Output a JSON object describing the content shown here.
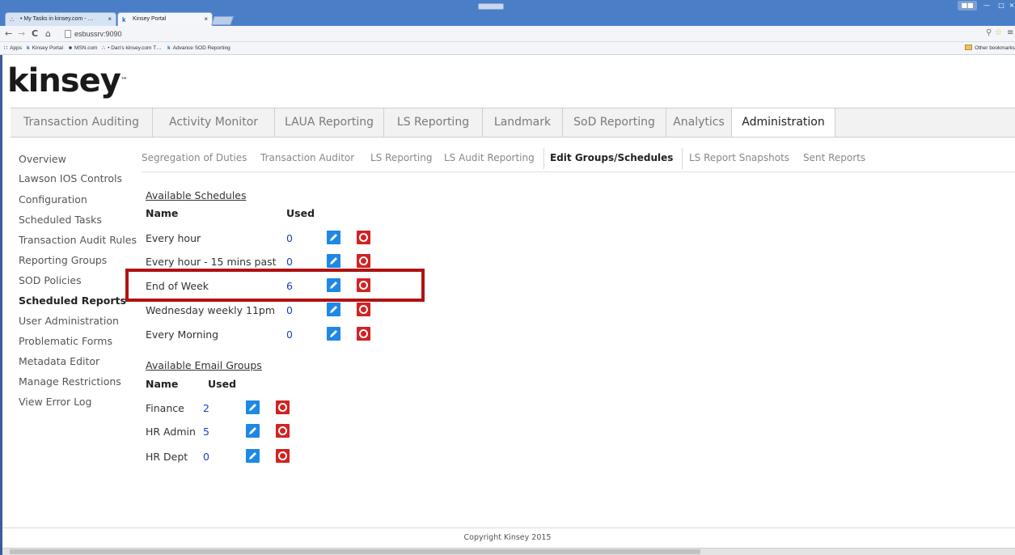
{
  "browser": {
    "tabs": [
      {
        "label": "• My Tasks in kinsey.com - …",
        "icon": "asana-icon"
      },
      {
        "label": "Kinsey Portal",
        "icon": "kinsey-icon"
      }
    ],
    "url": "esbussrv:9090",
    "bookmarks": [
      "Apps",
      "Kinsey Portal",
      "MSN.com",
      "• Dan's kinsey.com T…",
      "Advance SOD Reporting"
    ],
    "other_bookmarks": "Other bookmarks"
  },
  "logo": {
    "text": "kinsey",
    "mark": "™"
  },
  "topnav": [
    "Transaction Auditing",
    "Activity Monitor",
    "LAUA Reporting",
    "LS Reporting",
    "Landmark",
    "SoD Reporting",
    "Analytics",
    "Administration"
  ],
  "topnav_active": "Administration",
  "sidebar": [
    "Overview",
    "Lawson IOS Controls",
    "Configuration",
    "Scheduled Tasks",
    "Transaction Audit Rules",
    "Reporting Groups",
    "SOD Policies",
    "Scheduled Reports",
    "User Administration",
    "Problematic Forms",
    "Metadata Editor",
    "Manage Restrictions",
    "View Error Log"
  ],
  "sidebar_active": "Scheduled Reports",
  "subnav": [
    "Segregation of Duties",
    "Transaction Auditor",
    "LS Reporting",
    "LS Audit Reporting",
    "Edit Groups/Schedules",
    "LS Report Snapshots",
    "Sent Reports"
  ],
  "subnav_active": "Edit Groups/Schedules",
  "schedules": {
    "title": "Available Schedules",
    "col_name": "Name",
    "col_used": "Used",
    "rows": [
      {
        "name": "Every hour",
        "used": "0"
      },
      {
        "name": "Every hour - 15 mins past",
        "used": "0"
      },
      {
        "name": "End of Week",
        "used": "6",
        "highlighted": true
      },
      {
        "name": "Wednesday weekly 11pm",
        "used": "0"
      },
      {
        "name": "Every Morning",
        "used": "0"
      }
    ]
  },
  "email_groups": {
    "title": "Available Email Groups",
    "col_name": "Name",
    "col_used": "Used",
    "rows": [
      {
        "name": "Finance",
        "used": "2"
      },
      {
        "name": "HR Admin",
        "used": "5"
      },
      {
        "name": "HR Dept",
        "used": "0"
      }
    ]
  },
  "footer": "Copyright Kinsey 2015",
  "colors": {
    "accent_edit": "#1e88e5",
    "delete": "#d32222",
    "highlight": "#b01212",
    "link_number": "#1a3fc9"
  }
}
